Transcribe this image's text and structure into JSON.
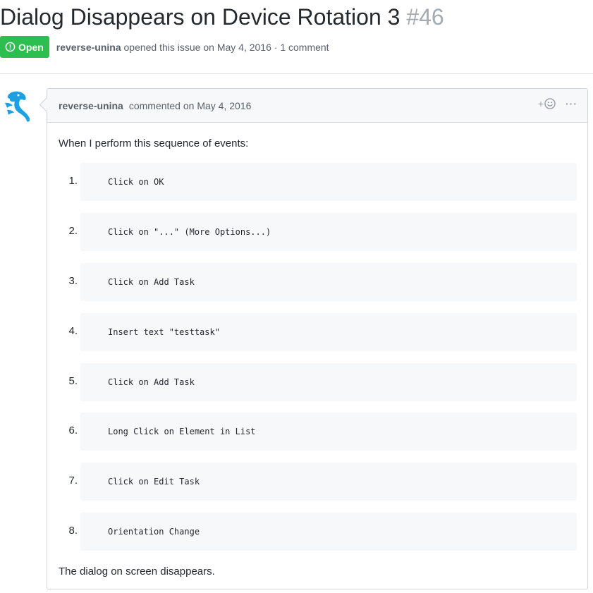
{
  "issue": {
    "title": "Dialog Disappears on Device Rotation 3",
    "number": "#46",
    "status": "Open",
    "author": "reverse-unina",
    "opened_text": "opened this issue on May 4, 2016",
    "separator": "·",
    "comment_count": "1 comment"
  },
  "comment": {
    "author": "reverse-unina",
    "commented_text": "commented on May 4, 2016",
    "reaction_plus": "+",
    "more_label": "···",
    "intro": "When I perform this sequence of events:",
    "steps": [
      {
        "num": "1.",
        "code": "Click on OK"
      },
      {
        "num": "2.",
        "code": "Click on \"...\" (More Options...)"
      },
      {
        "num": "3.",
        "code": "Click on Add Task"
      },
      {
        "num": "4.",
        "code": "Insert text \"testtask\""
      },
      {
        "num": "5.",
        "code": "Click on Add Task"
      },
      {
        "num": "6.",
        "code": "Long Click on Element in List"
      },
      {
        "num": "7.",
        "code": "Click on Edit Task"
      },
      {
        "num": "8.",
        "code": "Orientation Change"
      }
    ],
    "outro": "The dialog on screen disappears."
  },
  "colors": {
    "open_badge": "#2cbe4e",
    "avatar_blue": "#1ba1e2",
    "muted_text": "#586069",
    "code_bg": "#f6f8fa"
  }
}
